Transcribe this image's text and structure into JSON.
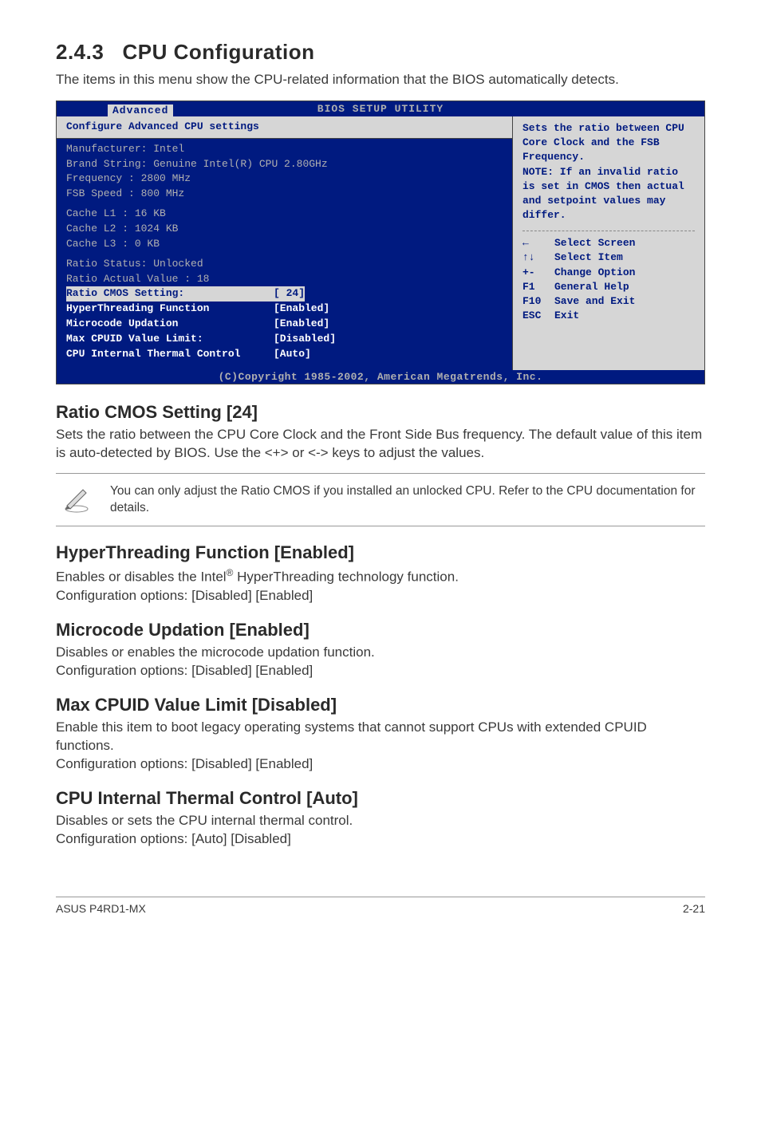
{
  "section": {
    "number": "2.4.3",
    "title": "CPU Configuration",
    "intro": "The items in this menu show the CPU-related information that the BIOS automatically detects."
  },
  "bios": {
    "title": "BIOS SETUP UTILITY",
    "tab": "Advanced",
    "left_header": "Configure Advanced CPU settings",
    "info": {
      "manufacturer": "Manufacturer: Intel",
      "brand": "Brand String: Genuine Intel(R) CPU 2.80GHz",
      "frequency": "Frequency   : 2800 MHz",
      "fsb": "FSB Speed   : 800 MHz",
      "l1": "Cache L1    : 16 KB",
      "l2": "Cache L2    : 1024 KB",
      "l3": "Cache L3    : 0 KB",
      "ratio_status": "Ratio Status: Unlocked",
      "ratio_actual": "Ratio Actual Value : 18"
    },
    "settings": [
      {
        "label": "Ratio CMOS Setting:",
        "value": "[ 24]",
        "highlight": true
      },
      {
        "label": "HyperThreading Function",
        "value": "[Enabled]",
        "highlight": false
      },
      {
        "label": "Microcode Updation",
        "value": "[Enabled]",
        "highlight": false
      },
      {
        "label": "Max CPUID Value Limit:",
        "value": "[Disabled]",
        "highlight": false
      },
      {
        "label": "CPU Internal Thermal Control",
        "value": "[Auto]",
        "highlight": false
      }
    ],
    "help": "Sets the ratio between CPU Core Clock and the FSB Frequency.\nNOTE: If an invalid ratio is set in CMOS then actual and setpoint values may differ.",
    "nav": [
      {
        "key": "←",
        "label": "Select Screen"
      },
      {
        "key": "↑↓",
        "label": "Select Item"
      },
      {
        "key": "+-",
        "label": "Change Option"
      },
      {
        "key": "F1",
        "label": "General Help"
      },
      {
        "key": "F10",
        "label": "Save and Exit"
      },
      {
        "key": "ESC",
        "label": "Exit"
      }
    ],
    "footer": "(C)Copyright 1985-2002, American Megatrends, Inc."
  },
  "settings_doc": {
    "ratio": {
      "title": "Ratio CMOS Setting [24]",
      "body": "Sets the ratio between the CPU Core Clock and the Front Side Bus frequency. The default value of this item is auto-detected by BIOS. Use the <+> or <-> keys to adjust the values.",
      "note": "You can only adjust the Ratio CMOS if you installed an unlocked CPU. Refer to the CPU documentation for details."
    },
    "ht": {
      "title": "HyperThreading Function [Enabled]",
      "body1": "Enables or disables the Intel",
      "body2": " HyperThreading technology function.",
      "opts": "Configuration options: [Disabled] [Enabled]"
    },
    "mc": {
      "title": "Microcode Updation [Enabled]",
      "body": "Disables or enables the microcode updation function.",
      "opts": "Configuration options: [Disabled] [Enabled]"
    },
    "cpuid": {
      "title": "Max CPUID Value Limit [Disabled]",
      "body": "Enable this item to boot legacy operating systems that cannot support CPUs with extended CPUID functions.",
      "opts": "Configuration options: [Disabled] [Enabled]"
    },
    "thermal": {
      "title": "CPU Internal Thermal Control [Auto]",
      "body": "Disables or sets the CPU internal thermal control.",
      "opts": "Configuration options: [Auto] [Disabled]"
    }
  },
  "footer": {
    "left": "ASUS P4RD1-MX",
    "right": "2-21"
  }
}
